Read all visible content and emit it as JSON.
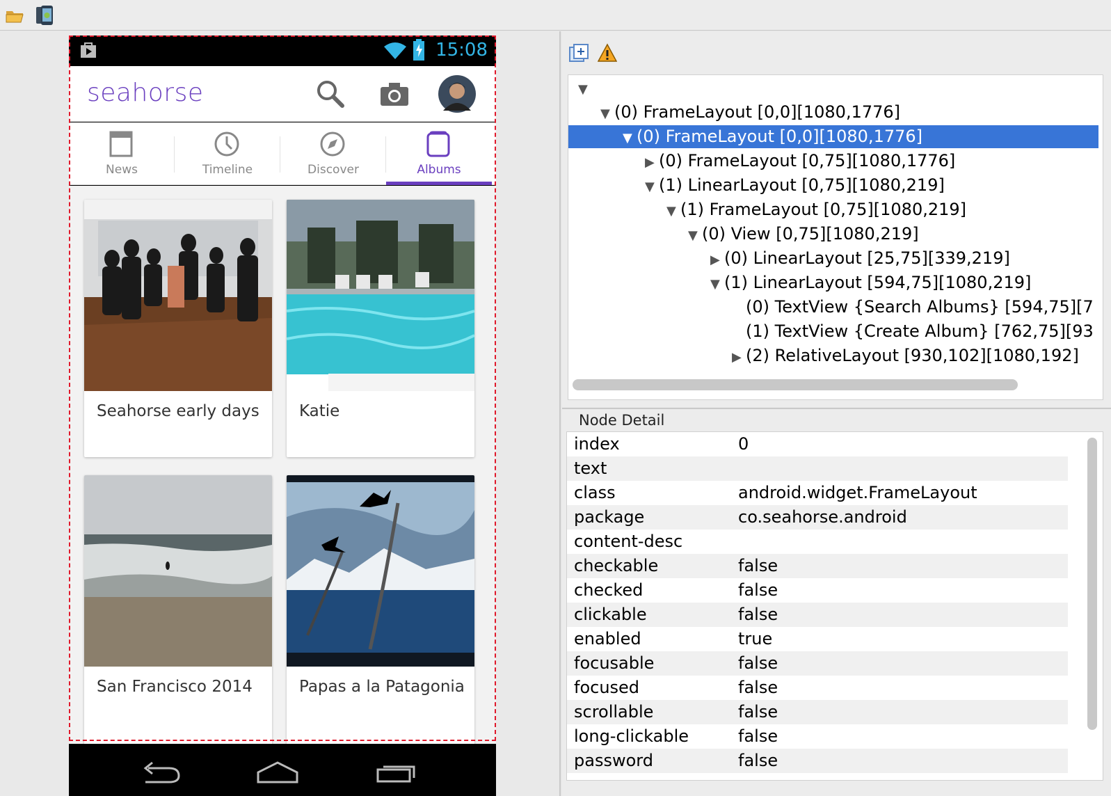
{
  "toolbar": {
    "open_icon": "folder-open-icon",
    "device_icon": "android-device-screenshot-icon"
  },
  "phone": {
    "status_time": "15:08",
    "app_title": "seahorse",
    "tabs": [
      {
        "label": "News",
        "icon": "news-icon"
      },
      {
        "label": "Timeline",
        "icon": "clock-icon"
      },
      {
        "label": "Discover",
        "icon": "compass-icon"
      },
      {
        "label": "Albums",
        "icon": "albums-icon"
      }
    ],
    "active_tab": "Albums",
    "cards": [
      {
        "title": "Seahorse early days"
      },
      {
        "title": "Katie"
      },
      {
        "title": "San Francisco 2014"
      },
      {
        "title": "Papas a la Patagonia"
      }
    ],
    "accent_color": "#6a3fbf"
  },
  "tree": {
    "rows": [
      {
        "text": "(0) FrameLayout [0,0][1080,1776]"
      },
      {
        "text": "(0) FrameLayout [0,0][1080,1776]"
      },
      {
        "text": "(0) FrameLayout [0,75][1080,1776]"
      },
      {
        "text": "(1) LinearLayout [0,75][1080,219]"
      },
      {
        "text": "(1) FrameLayout [0,75][1080,219]"
      },
      {
        "text": "(0) View [0,75][1080,219]"
      },
      {
        "text": "(0) LinearLayout [25,75][339,219]"
      },
      {
        "text": "(1) LinearLayout [594,75][1080,219]"
      },
      {
        "text": "(0) TextView {Search Albums} [594,75][7"
      },
      {
        "text": "(1) TextView {Create Album} [762,75][93"
      },
      {
        "text": "(2) RelativeLayout [930,102][1080,192]"
      }
    ],
    "selection_color": "#3875d7"
  },
  "detail": {
    "title": "Node Detail",
    "rows": [
      {
        "key": "index",
        "value": "0"
      },
      {
        "key": "text",
        "value": ""
      },
      {
        "key": "class",
        "value": "android.widget.FrameLayout"
      },
      {
        "key": "package",
        "value": "co.seahorse.android"
      },
      {
        "key": "content-desc",
        "value": ""
      },
      {
        "key": "checkable",
        "value": "false"
      },
      {
        "key": "checked",
        "value": "false"
      },
      {
        "key": "clickable",
        "value": "false"
      },
      {
        "key": "enabled",
        "value": "true"
      },
      {
        "key": "focusable",
        "value": "false"
      },
      {
        "key": "focused",
        "value": "false"
      },
      {
        "key": "scrollable",
        "value": "false"
      },
      {
        "key": "long-clickable",
        "value": "false"
      },
      {
        "key": "password",
        "value": "false"
      }
    ]
  }
}
